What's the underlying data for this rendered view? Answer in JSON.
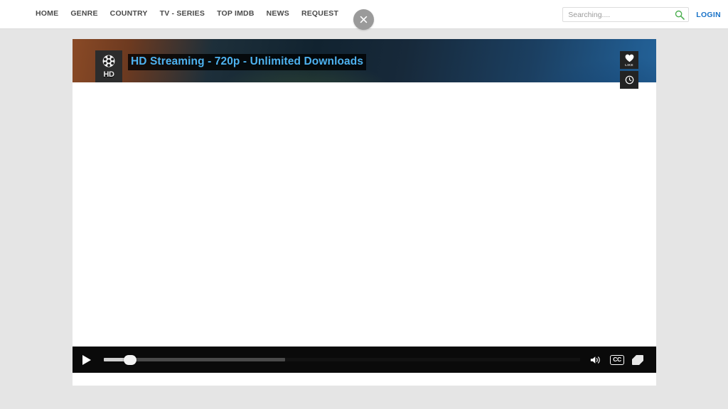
{
  "header": {
    "nav": [
      {
        "label": "HOME",
        "name": "nav-home"
      },
      {
        "label": "GENRE",
        "name": "nav-genre"
      },
      {
        "label": "COUNTRY",
        "name": "nav-country"
      },
      {
        "label": "TV - SERIES",
        "name": "nav-tv-series"
      },
      {
        "label": "TOP IMDb",
        "name": "nav-top-imdb"
      },
      {
        "label": "NEWS",
        "name": "nav-news"
      },
      {
        "label": "REQUEST",
        "name": "nav-request"
      }
    ],
    "search": {
      "placeholder": "Searching....",
      "value": "",
      "icon": "search-icon",
      "icon_color": "#4caf50"
    },
    "login_label": "LOGIN",
    "login_color": "#1a73c8",
    "background": "#ffffff"
  },
  "close_button": {
    "glyph": "✕",
    "label": "close",
    "background": "#9a9a9a"
  },
  "player": {
    "banner": {
      "title": "HD Streaming - 720p - Unlimited Downloads",
      "title_color": "#4eb2ef",
      "badge": {
        "quality_label": "HD",
        "icon": "film-reel-icon"
      }
    },
    "side_actions": [
      {
        "name": "like-button",
        "icon": "heart-icon",
        "caption": "LIKE",
        "glyph": "♥"
      },
      {
        "name": "watch-later-button",
        "icon": "clock-icon",
        "caption": "",
        "glyph": "◴"
      }
    ],
    "controls": {
      "play": {
        "label": "Play",
        "icon": "play-icon"
      },
      "progress": {
        "played_percent": 5,
        "buffered_percent": 38
      },
      "volume": {
        "label": "Volume",
        "icon": "volume-icon"
      },
      "captions": {
        "label": "CC",
        "icon": "closed-captions-icon"
      },
      "fullscreen": {
        "label": "Fullscreen",
        "icon": "fullscreen-icon"
      }
    }
  },
  "page": {
    "background": "#e5e5e5",
    "stage_background": "#ffffff"
  }
}
